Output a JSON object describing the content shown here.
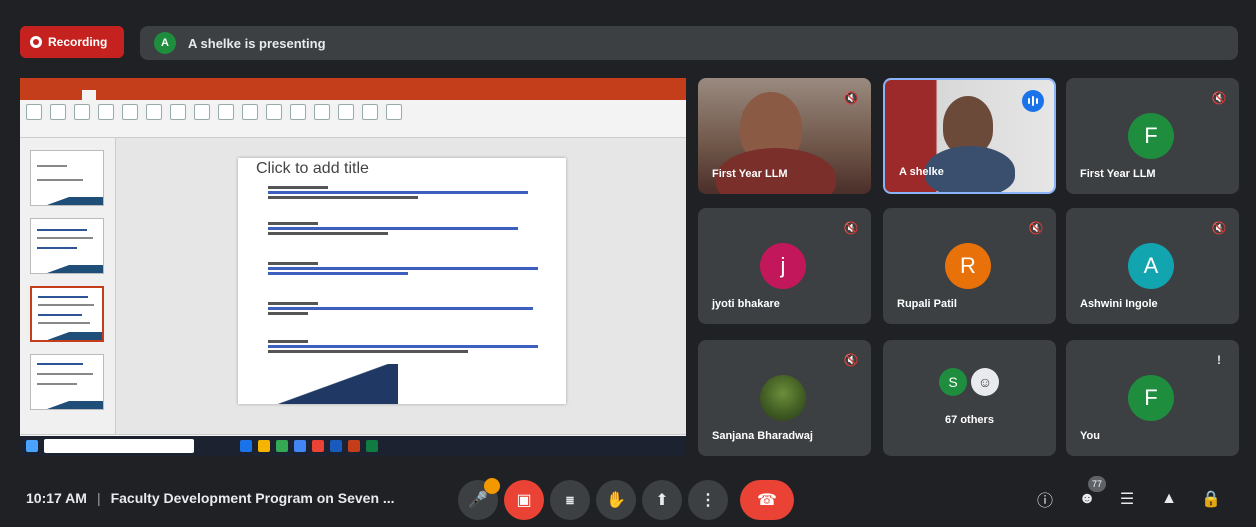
{
  "recording": {
    "label": "Recording"
  },
  "presenting": {
    "avatar_letter": "A",
    "text": "A shelke is presenting"
  },
  "shared_screen": {
    "slide_title": "Click to add title"
  },
  "tiles": [
    {
      "name": "First Year LLM",
      "type": "video"
    },
    {
      "name": "A shelke",
      "type": "video",
      "speaking": true
    },
    {
      "name": "First Year LLM",
      "letter": "F",
      "color": "#1e8e3e"
    },
    {
      "name": "jyoti bhakare",
      "letter": "j",
      "color": "#c2185b"
    },
    {
      "name": "Rupali Patil",
      "letter": "R",
      "color": "#e8710a"
    },
    {
      "name": "Ashwini Ingole",
      "letter": "A",
      "color": "#12a4af"
    },
    {
      "name": "Sanjana Bharadwaj",
      "type": "photo"
    },
    {
      "name": "67 others",
      "letter": "S",
      "color": "#1e8e3e"
    },
    {
      "name": "You",
      "letter": "F",
      "color": "#1e8e3e"
    }
  ],
  "bottom": {
    "time": "10:17 AM",
    "separator": "|",
    "meeting_title": "Faculty Development Program on Seven ...",
    "participant_count": "77"
  }
}
